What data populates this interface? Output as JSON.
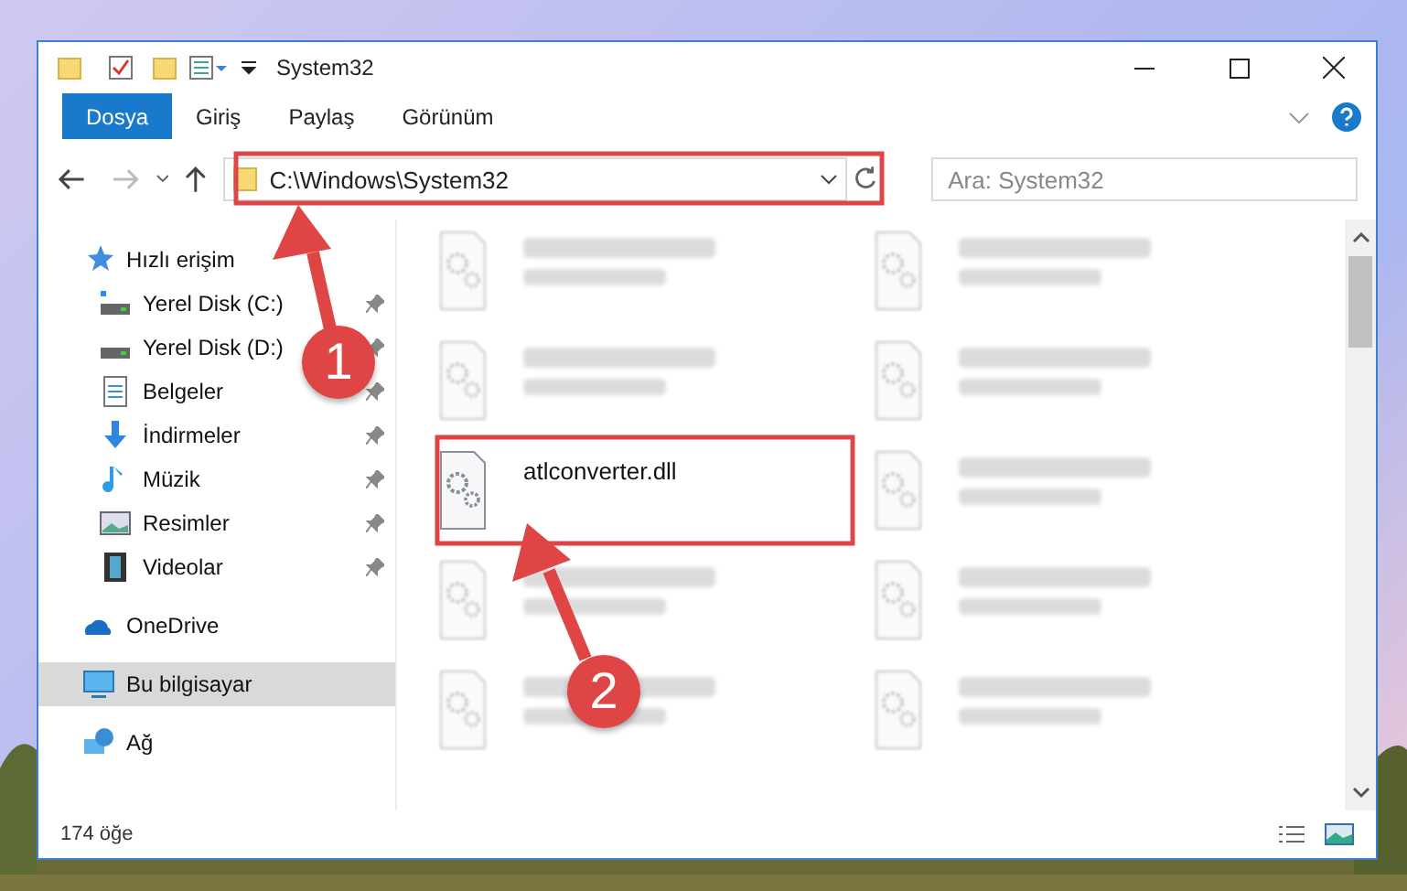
{
  "window": {
    "title": "System32"
  },
  "ribbon_tabs": [
    {
      "label": "Dosya",
      "selected": true
    },
    {
      "label": "Giriş",
      "selected": false
    },
    {
      "label": "Paylaş",
      "selected": false
    },
    {
      "label": "Görünüm",
      "selected": false
    }
  ],
  "address": {
    "value": "C:\\Windows\\System32"
  },
  "search": {
    "placeholder": "Ara: System32"
  },
  "navigation": [
    {
      "label": "Hızlı erişim",
      "kind": "star",
      "selected": false,
      "children": [
        {
          "label": "Yerel Disk (C:)",
          "kind": "disk-c",
          "pinned": true,
          "selected": false
        },
        {
          "label": "Yerel Disk (D:)",
          "kind": "disk",
          "pinned": true,
          "selected": false
        },
        {
          "label": "Belgeler",
          "kind": "docs",
          "pinned": true,
          "selected": false
        },
        {
          "label": "İndirmeler",
          "kind": "download",
          "pinned": true,
          "selected": false
        },
        {
          "label": "Müzik",
          "kind": "music",
          "pinned": true,
          "selected": false
        },
        {
          "label": "Resimler",
          "kind": "pictures",
          "pinned": true,
          "selected": false
        },
        {
          "label": "Videolar",
          "kind": "videos",
          "pinned": true,
          "selected": false
        }
      ]
    },
    {
      "label": "OneDrive",
      "kind": "cloud",
      "selected": false
    },
    {
      "label": "Bu bilgisayar",
      "kind": "pc",
      "selected": true
    },
    {
      "label": "Ağ",
      "kind": "network",
      "selected": false
    }
  ],
  "files": [
    {
      "blurred": true,
      "highlighted": false
    },
    {
      "blurred": true,
      "highlighted": false
    },
    {
      "blurred": true,
      "highlighted": false
    },
    {
      "blurred": true,
      "highlighted": false
    },
    {
      "name": "atlconverter.dll",
      "blurred": false,
      "highlighted": true
    },
    {
      "blurred": true,
      "highlighted": false
    },
    {
      "blurred": true,
      "highlighted": false
    },
    {
      "blurred": true,
      "highlighted": false
    },
    {
      "blurred": true,
      "highlighted": false
    },
    {
      "blurred": true,
      "highlighted": false
    }
  ],
  "status_bar": {
    "count": "174 öğe"
  },
  "callouts": [
    {
      "number": "1"
    },
    {
      "number": "2"
    }
  ]
}
